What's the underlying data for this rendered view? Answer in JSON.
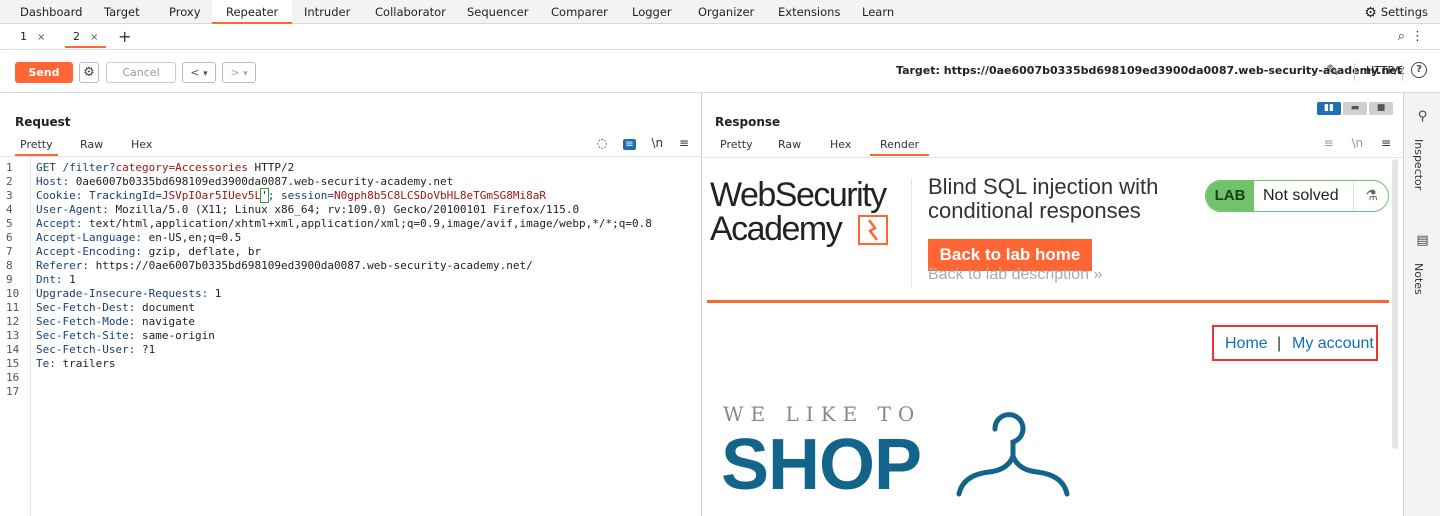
{
  "menu": {
    "items": [
      "Dashboard",
      "Target",
      "Proxy",
      "Repeater",
      "Intruder",
      "Collaborator",
      "Sequencer",
      "Comparer",
      "Logger",
      "Organizer",
      "Extensions",
      "Learn"
    ],
    "active": "Repeater",
    "settings_label": "Settings"
  },
  "repeater_tabs": [
    {
      "label": "1",
      "close": "×"
    },
    {
      "label": "2",
      "close": "×"
    }
  ],
  "add_tab": "+",
  "toolbar": {
    "send_label": "Send",
    "cancel_label": "Cancel",
    "back_label": "<",
    "forward_label": ">",
    "dropdown_glyph": "▾",
    "target_text": "Target: https://0ae6007b0335bd698109ed3900da0087.web-security-academy.net",
    "protocol": "HTTP/2",
    "help_glyph": "?"
  },
  "request": {
    "title": "Request",
    "tabs": [
      "Pretty",
      "Raw",
      "Hex"
    ],
    "active_tab": "Pretty",
    "newline_toggle": "\\n",
    "lines": [
      {
        "n": "1",
        "k": "GET /filter?",
        "v": "category=Accessories",
        "rest": " HTTP/2"
      },
      {
        "n": "2",
        "k": "Host:",
        "v": "",
        "rest": " 0ae6007b0335bd698109ed3900da0087.web-security-academy.net"
      },
      {
        "n": "3",
        "k": "Cookie:",
        "v": "",
        "rest": ""
      },
      {
        "n": "4",
        "k": "User-Agent:",
        "v": "",
        "rest": " Mozilla/5.0 (X11; Linux x86_64; rv:109.0) Gecko/20100101 Firefox/115.0"
      },
      {
        "n": "5",
        "k": "Accept:",
        "v": "",
        "rest": " text/html,application/xhtml+xml,application/xml;q=0.9,image/avif,image/webp,*/*;q=0.8"
      },
      {
        "n": "6",
        "k": "Accept-Language:",
        "v": "",
        "rest": " en-US,en;q=0.5"
      },
      {
        "n": "7",
        "k": "Accept-Encoding:",
        "v": "",
        "rest": " gzip, deflate, br"
      },
      {
        "n": "8",
        "k": "Referer:",
        "v": "",
        "rest": " https://0ae6007b0335bd698109ed3900da0087.web-security-academy.net/"
      },
      {
        "n": "9",
        "k": "Dnt:",
        "v": "",
        "rest": " 1"
      },
      {
        "n": "10",
        "k": "Upgrade-Insecure-Requests:",
        "v": "",
        "rest": " 1"
      },
      {
        "n": "11",
        "k": "Sec-Fetch-Dest:",
        "v": "",
        "rest": " document"
      },
      {
        "n": "12",
        "k": "Sec-Fetch-Mode:",
        "v": "",
        "rest": " navigate"
      },
      {
        "n": "13",
        "k": "Sec-Fetch-Site:",
        "v": "",
        "rest": " same-origin"
      },
      {
        "n": "14",
        "k": "Sec-Fetch-User:",
        "v": "",
        "rest": " ?1"
      },
      {
        "n": "15",
        "k": "Te:",
        "v": "",
        "rest": " trailers"
      },
      {
        "n": "16",
        "k": "",
        "v": "",
        "rest": ""
      },
      {
        "n": "17",
        "k": "",
        "v": "",
        "rest": ""
      }
    ],
    "cookie": {
      "prefix": " TrackingId=",
      "tracking_value": "JSVpIOar5IUev5L",
      "injected": "'",
      "separator": "; session=",
      "session_value": "N0gph8b5C8LCSDoVbHL8eTGmSG8Mi8aR"
    }
  },
  "response": {
    "title": "Response",
    "tabs": [
      "Pretty",
      "Raw",
      "Hex",
      "Render"
    ],
    "active_tab": "Render",
    "newline_toggle": "\\n",
    "render": {
      "logo_line1": "WebSecurity",
      "logo_line2": "Academy",
      "lab_title": "Blind SQL injection with conditional responses",
      "lab_status_word": "LAB",
      "lab_status": "Not solved",
      "back_home": "Back to lab home",
      "back_desc": "Back to lab description",
      "back_desc_chevron": "»",
      "nav_home": "Home",
      "nav_sep": "|",
      "nav_account": "My account",
      "banner_small": "WE LIKE TO",
      "banner_big": "SHOP"
    }
  },
  "side_rail": {
    "inspector": "Inspector",
    "notes": "Notes"
  },
  "colors": {
    "accent": "#ff6633",
    "link": "#1470b8",
    "lab_green": "#70c36b",
    "shop_blue": "#13648a"
  }
}
